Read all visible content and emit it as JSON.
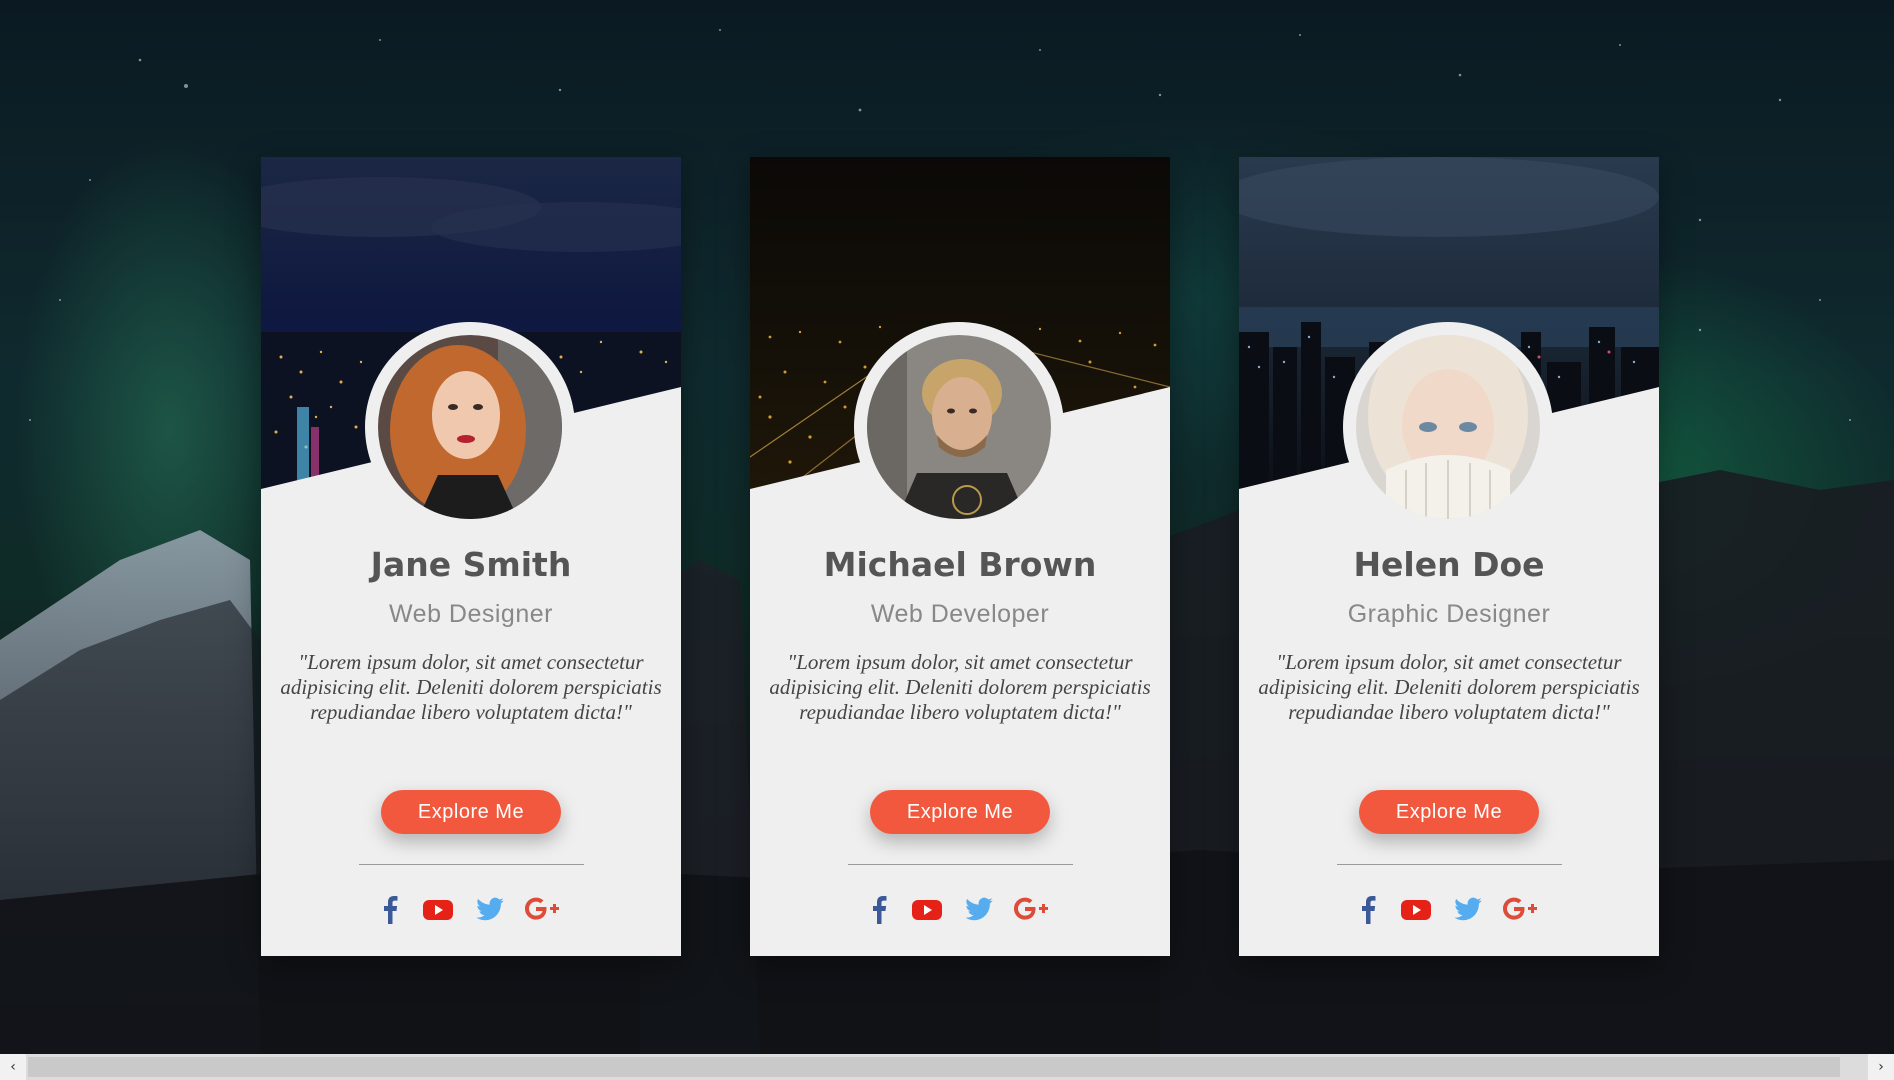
{
  "cards": [
    {
      "name": "Jane Smith",
      "role": "Web Designer",
      "quote": "\"Lorem ipsum dolor, sit amet consectetur adipisicing elit. Deleniti dolorem perspiciatis repudiandae libero voluptatem dicta!\"",
      "button_label": "Explore Me"
    },
    {
      "name": "Michael Brown",
      "role": "Web Developer",
      "quote": "\"Lorem ipsum dolor, sit amet consectetur adipisicing elit. Deleniti dolorem perspiciatis repudiandae libero voluptatem dicta!\"",
      "button_label": "Explore Me"
    },
    {
      "name": "Helen Doe",
      "role": "Graphic Designer",
      "quote": "\"Lorem ipsum dolor, sit amet consectetur adipisicing elit. Deleniti dolorem perspiciatis repudiandae libero voluptatem dicta!\"",
      "button_label": "Explore Me"
    }
  ],
  "social_icons": [
    "facebook-icon",
    "youtube-icon",
    "twitter-icon",
    "google-plus-icon"
  ],
  "colors": {
    "accent_button": "#f2583e",
    "facebook": "#3b5998",
    "youtube": "#e62117",
    "twitter": "#55acee",
    "google_plus": "#dd4b39",
    "card_background": "#efefef"
  },
  "scrollbar": {
    "left_arrow": "‹",
    "right_arrow": "›"
  }
}
